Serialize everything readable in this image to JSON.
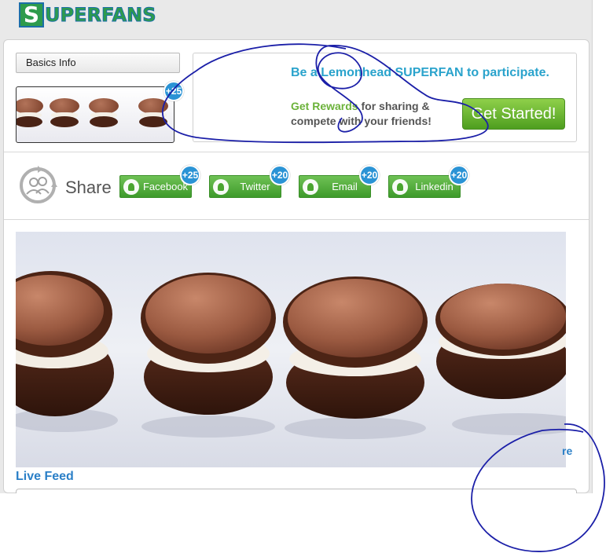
{
  "logo": {
    "initial": "S",
    "rest": "UPERFANS"
  },
  "profile": {
    "basics_label": "Basics Info",
    "thumb_badge": "+25"
  },
  "promo": {
    "headline": "Be a Lemonhead SUPERFAN to participate.",
    "rewards_highlight": "Get Rewards",
    "rewards_rest": " for sharing & compete with your friends!",
    "cta_label": "Get Started!"
  },
  "share": {
    "label": "Share",
    "buttons": [
      {
        "label": "Facebook",
        "badge": "+25"
      },
      {
        "label": "Twitter",
        "badge": "+20"
      },
      {
        "label": "Email",
        "badge": "+20"
      },
      {
        "label": "Linkedin",
        "badge": "+20"
      }
    ]
  },
  "feed": {
    "more_text": "re",
    "title": "Live Feed"
  },
  "colors": {
    "brand_green": "#2e9b4c",
    "accent_blue": "#2a93d5",
    "cta_green": "#6fc255",
    "headline_cyan": "#2aa3cc",
    "annotation_ink": "#1b1fa8"
  }
}
